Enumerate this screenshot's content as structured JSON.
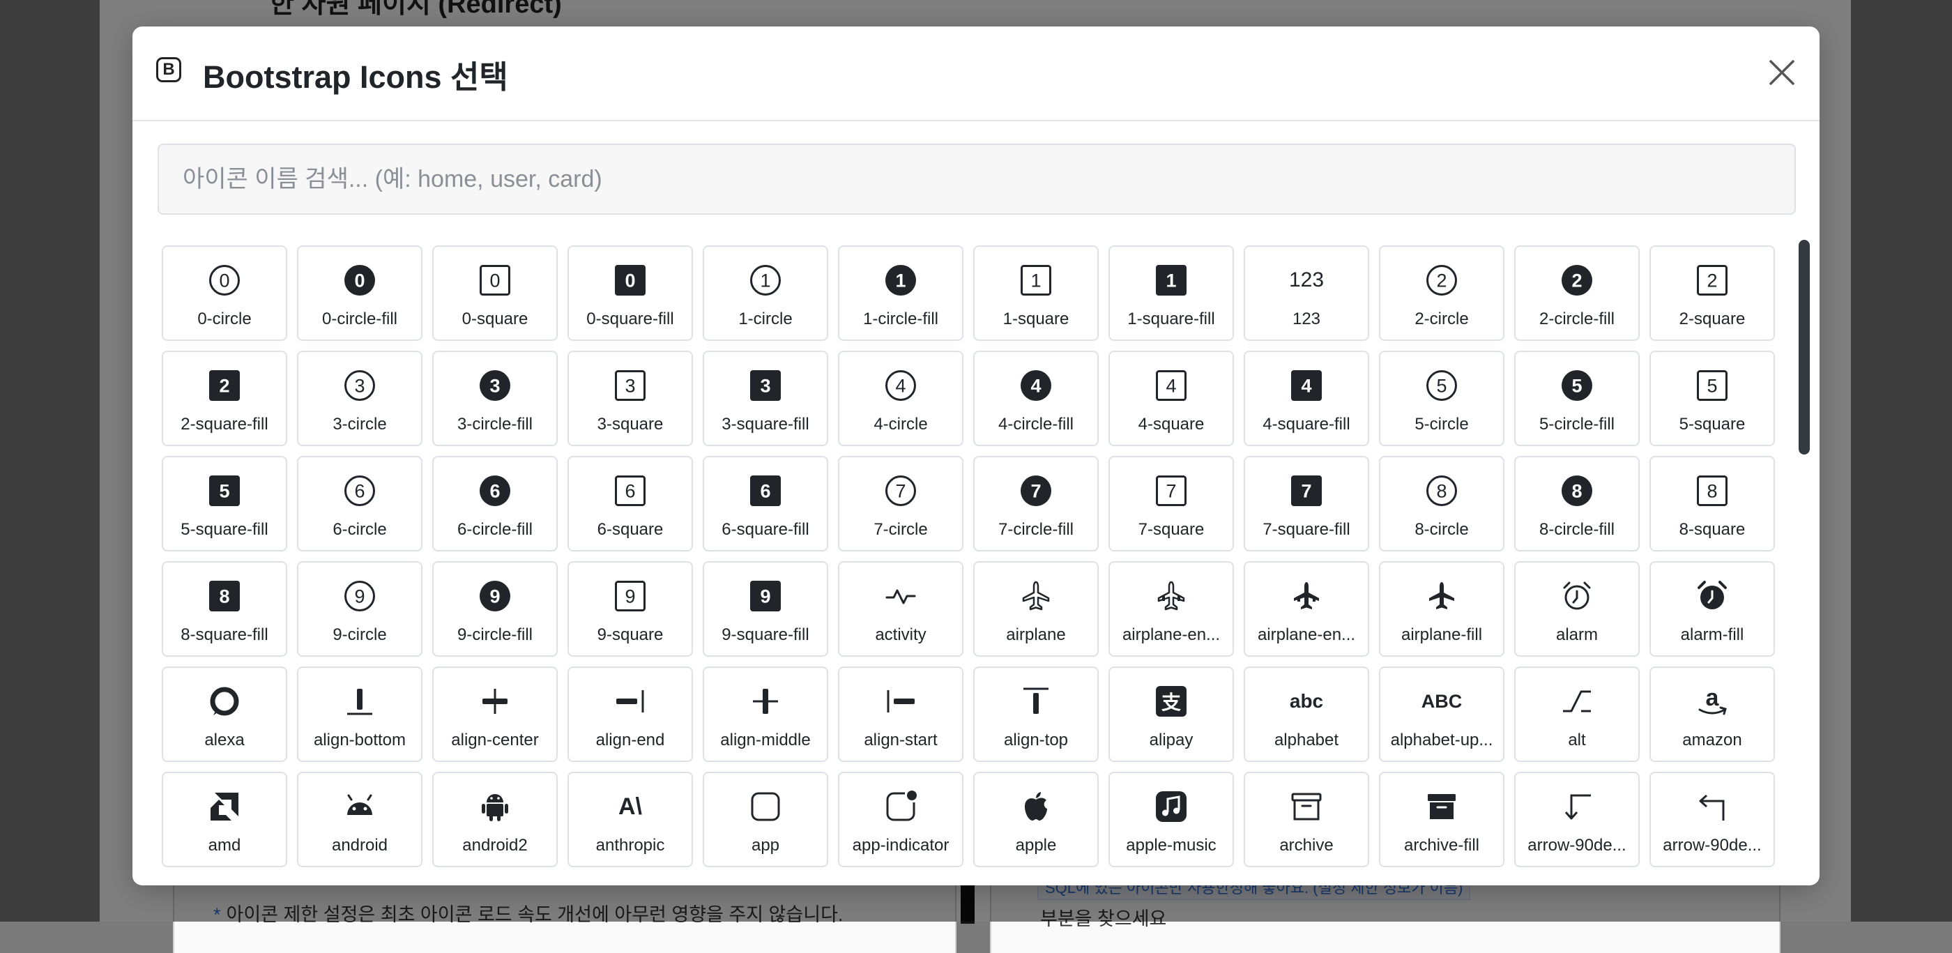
{
  "background": {
    "heading": "한 자원 페이지 (Redirect)",
    "note_star": "*",
    "note_text": "아이콘 제한 설정은 최초 아이콘 로드 속도 개선에 아무런 영향을 주지 않습니다.",
    "code_snippet": "SQL에 있는 아이콘만 사용한정해 놓아요. (설정 제한 정보가 이름)",
    "after_text": "부분을 찾으세요"
  },
  "modal": {
    "brand_letter": "B",
    "title": "Bootstrap Icons 선택",
    "search": {
      "placeholder": "아이콘 이름 검색... (예: home, user, card)",
      "value": ""
    },
    "icons": [
      {
        "label": "0-circle",
        "icon": "0-circle"
      },
      {
        "label": "0-circle-fill",
        "icon": "0-circle-fill"
      },
      {
        "label": "0-square",
        "icon": "0-square"
      },
      {
        "label": "0-square-fill",
        "icon": "0-square-fill"
      },
      {
        "label": "1-circle",
        "icon": "1-circle"
      },
      {
        "label": "1-circle-fill",
        "icon": "1-circle-fill"
      },
      {
        "label": "1-square",
        "icon": "1-square"
      },
      {
        "label": "1-square-fill",
        "icon": "1-square-fill"
      },
      {
        "label": "123",
        "icon": "123"
      },
      {
        "label": "2-circle",
        "icon": "2-circle"
      },
      {
        "label": "2-circle-fill",
        "icon": "2-circle-fill"
      },
      {
        "label": "2-square",
        "icon": "2-square"
      },
      {
        "label": "2-square-fill",
        "icon": "2-square-fill"
      },
      {
        "label": "3-circle",
        "icon": "3-circle"
      },
      {
        "label": "3-circle-fill",
        "icon": "3-circle-fill"
      },
      {
        "label": "3-square",
        "icon": "3-square"
      },
      {
        "label": "3-square-fill",
        "icon": "3-square-fill"
      },
      {
        "label": "4-circle",
        "icon": "4-circle"
      },
      {
        "label": "4-circle-fill",
        "icon": "4-circle-fill"
      },
      {
        "label": "4-square",
        "icon": "4-square"
      },
      {
        "label": "4-square-fill",
        "icon": "4-square-fill"
      },
      {
        "label": "5-circle",
        "icon": "5-circle"
      },
      {
        "label": "5-circle-fill",
        "icon": "5-circle-fill"
      },
      {
        "label": "5-square",
        "icon": "5-square"
      },
      {
        "label": "5-square-fill",
        "icon": "5-square-fill"
      },
      {
        "label": "6-circle",
        "icon": "6-circle"
      },
      {
        "label": "6-circle-fill",
        "icon": "6-circle-fill"
      },
      {
        "label": "6-square",
        "icon": "6-square"
      },
      {
        "label": "6-square-fill",
        "icon": "6-square-fill"
      },
      {
        "label": "7-circle",
        "icon": "7-circle"
      },
      {
        "label": "7-circle-fill",
        "icon": "7-circle-fill"
      },
      {
        "label": "7-square",
        "icon": "7-square"
      },
      {
        "label": "7-square-fill",
        "icon": "7-square-fill"
      },
      {
        "label": "8-circle",
        "icon": "8-circle"
      },
      {
        "label": "8-circle-fill",
        "icon": "8-circle-fill"
      },
      {
        "label": "8-square",
        "icon": "8-square"
      },
      {
        "label": "8-square-fill",
        "icon": "8-square-fill"
      },
      {
        "label": "9-circle",
        "icon": "9-circle"
      },
      {
        "label": "9-circle-fill",
        "icon": "9-circle-fill"
      },
      {
        "label": "9-square",
        "icon": "9-square"
      },
      {
        "label": "9-square-fill",
        "icon": "9-square-fill"
      },
      {
        "label": "activity",
        "icon": "activity"
      },
      {
        "label": "airplane",
        "icon": "airplane"
      },
      {
        "label": "airplane-en...",
        "icon": "airplane-engines"
      },
      {
        "label": "airplane-en...",
        "icon": "airplane-engines-fill"
      },
      {
        "label": "airplane-fill",
        "icon": "airplane-fill"
      },
      {
        "label": "alarm",
        "icon": "alarm"
      },
      {
        "label": "alarm-fill",
        "icon": "alarm-fill"
      },
      {
        "label": "alexa",
        "icon": "alexa"
      },
      {
        "label": "align-bottom",
        "icon": "align-bottom"
      },
      {
        "label": "align-center",
        "icon": "align-center"
      },
      {
        "label": "align-end",
        "icon": "align-end"
      },
      {
        "label": "align-middle",
        "icon": "align-middle"
      },
      {
        "label": "align-start",
        "icon": "align-start"
      },
      {
        "label": "align-top",
        "icon": "align-top"
      },
      {
        "label": "alipay",
        "icon": "alipay"
      },
      {
        "label": "alphabet",
        "icon": "alphabet"
      },
      {
        "label": "alphabet-up...",
        "icon": "alphabet-uppercase"
      },
      {
        "label": "alt",
        "icon": "alt"
      },
      {
        "label": "amazon",
        "icon": "amazon"
      },
      {
        "label": "amd",
        "icon": "amd"
      },
      {
        "label": "android",
        "icon": "android"
      },
      {
        "label": "android2",
        "icon": "android2"
      },
      {
        "label": "anthropic",
        "icon": "anthropic"
      },
      {
        "label": "app",
        "icon": "app"
      },
      {
        "label": "app-indicator",
        "icon": "app-indicator"
      },
      {
        "label": "apple",
        "icon": "apple"
      },
      {
        "label": "apple-music",
        "icon": "apple-music"
      },
      {
        "label": "archive",
        "icon": "archive"
      },
      {
        "label": "archive-fill",
        "icon": "archive-fill"
      },
      {
        "label": "arrow-90de...",
        "icon": "arrow-90deg-down"
      },
      {
        "label": "arrow-90de...",
        "icon": "arrow-90deg-left"
      }
    ]
  },
  "icon_glyphs": {
    "123": "123",
    "alphabet": "abc",
    "alphabet-uppercase": "ABC",
    "anthropic": "A\\"
  }
}
